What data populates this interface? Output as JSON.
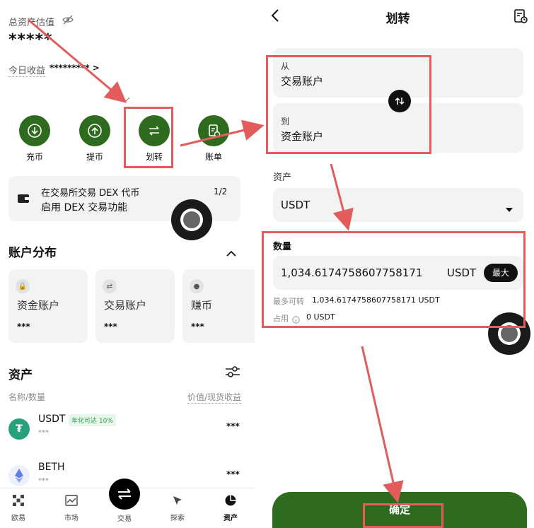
{
  "left": {
    "total_label": "总资产估值",
    "total_value": "*****",
    "today_label": "今日收益",
    "today_value": "********* >",
    "actions": [
      {
        "label": "充币",
        "icon": "deposit-icon"
      },
      {
        "label": "提币",
        "icon": "withdraw-icon"
      },
      {
        "label": "划转",
        "icon": "transfer-icon"
      },
      {
        "label": "账单",
        "icon": "bill-icon"
      }
    ],
    "banner": {
      "line1": "在交易所交易 DEX 代币",
      "line2": "启用 DEX 交易功能",
      "page": "1/2"
    },
    "distribution": {
      "title": "账户分布",
      "cards": [
        {
          "name": "资金账户",
          "value": "***"
        },
        {
          "name": "交易账户",
          "value": "***"
        },
        {
          "name": "赚币",
          "value": "***"
        }
      ]
    },
    "assets": {
      "title": "资产",
      "col_left": "名称/数量",
      "col_right": "价值/现货收益",
      "rows": [
        {
          "symbol": "USDT",
          "badge": "年化可达 10%",
          "sub": "***",
          "value": "***",
          "color": "#26a17b"
        },
        {
          "symbol": "BETH",
          "badge": "",
          "sub": "***",
          "value": "***",
          "color": "#627eea"
        }
      ]
    },
    "nav": [
      {
        "label": "欧易"
      },
      {
        "label": "市场"
      },
      {
        "label": "交易"
      },
      {
        "label": "探索"
      },
      {
        "label": "资产"
      }
    ]
  },
  "right": {
    "title": "划转",
    "from_label": "从",
    "from_value": "交易账户",
    "to_label": "到",
    "to_value": "资金账户",
    "asset_label": "资产",
    "asset_value": "USDT",
    "amount_label": "数量",
    "amount_value": "1,034.6174758607758171",
    "amount_unit": "USDT",
    "max_label": "最大",
    "available_label": "最多可转",
    "available_value": "1,034.6174758607758171 USDT",
    "occupied_label": "占用",
    "occupied_value": "0 USDT",
    "confirm_label": "确定"
  },
  "colors": {
    "brand_green": "#2f6b1f",
    "annotation_red": "#e25c5c",
    "badge_green": "#2e9e55"
  }
}
